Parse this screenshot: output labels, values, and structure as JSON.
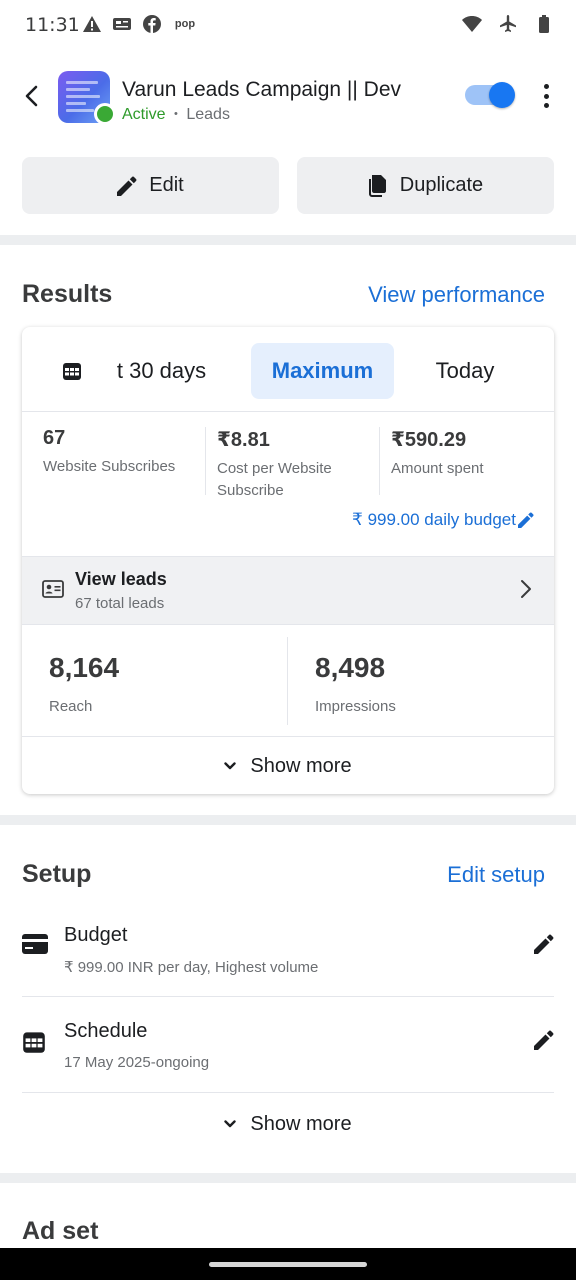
{
  "status_bar": {
    "time": "11:31",
    "left_icons": [
      "warning-icon",
      "news-icon",
      "facebook-icon",
      "pop-icon"
    ],
    "pop_label": "pop",
    "right_icons": [
      "wifi-icon",
      "airplane-icon",
      "battery-icon"
    ]
  },
  "header": {
    "campaign_name": "Varun Leads Campaign || Dev",
    "status": "Active",
    "separator": "•",
    "objective": "Leads",
    "toggle_on": true,
    "accent_color": "#1877f2"
  },
  "actions": {
    "edit_label": "Edit",
    "duplicate_label": "Duplicate"
  },
  "results": {
    "title": "Results",
    "view_performance": "View performance",
    "date_tabs": [
      {
        "label": "t 30 days",
        "selected": false
      },
      {
        "label": "Maximum",
        "selected": true
      },
      {
        "label": "Today",
        "selected": false
      }
    ],
    "metrics": [
      {
        "value": "67",
        "label": "Website Subscribes"
      },
      {
        "value": "₹8.81",
        "label": "Cost per Website Subscribe"
      },
      {
        "value": "₹590.29",
        "label": "Amount spent"
      }
    ],
    "daily_budget": "₹ 999.00 daily budget",
    "leads": {
      "title": "View leads",
      "subtitle": "67 total leads"
    },
    "reach": {
      "value": "8,164",
      "label": "Reach"
    },
    "impressions": {
      "value": "8,498",
      "label": "Impressions"
    },
    "show_more": "Show more"
  },
  "setup": {
    "title": "Setup",
    "edit_setup": "Edit setup",
    "items": [
      {
        "title": "Budget",
        "subtitle": "₹ 999.00 INR per day, Highest volume",
        "icon": "credit-card-icon"
      },
      {
        "title": "Schedule",
        "subtitle": "17 May 2025-ongoing",
        "icon": "calendar-icon"
      }
    ],
    "show_more": "Show more"
  },
  "ad_set": {
    "title": "Ad set"
  }
}
